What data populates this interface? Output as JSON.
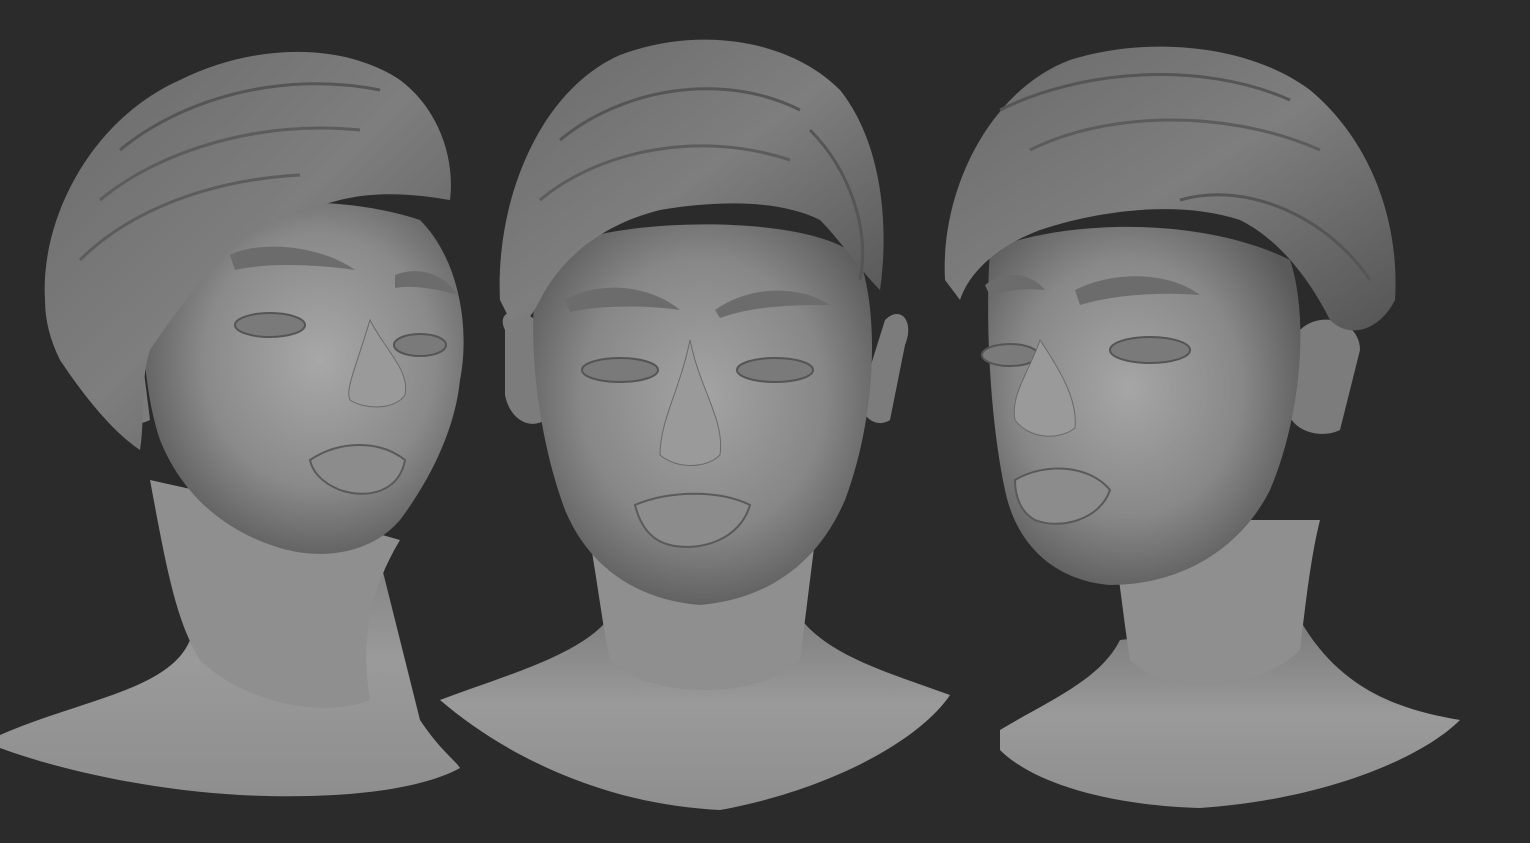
{
  "scene": {
    "background_color": "#2b2b2b",
    "clay_color": "#8c8c8c",
    "clay_dark": "#4a4a4a",
    "clay_light": "#b4b4b4",
    "views": [
      {
        "id": "left",
        "description_icon": "head-sculpt-three-quarter-left"
      },
      {
        "id": "front",
        "description_icon": "head-sculpt-front"
      },
      {
        "id": "right",
        "description_icon": "head-sculpt-three-quarter-right"
      }
    ]
  }
}
